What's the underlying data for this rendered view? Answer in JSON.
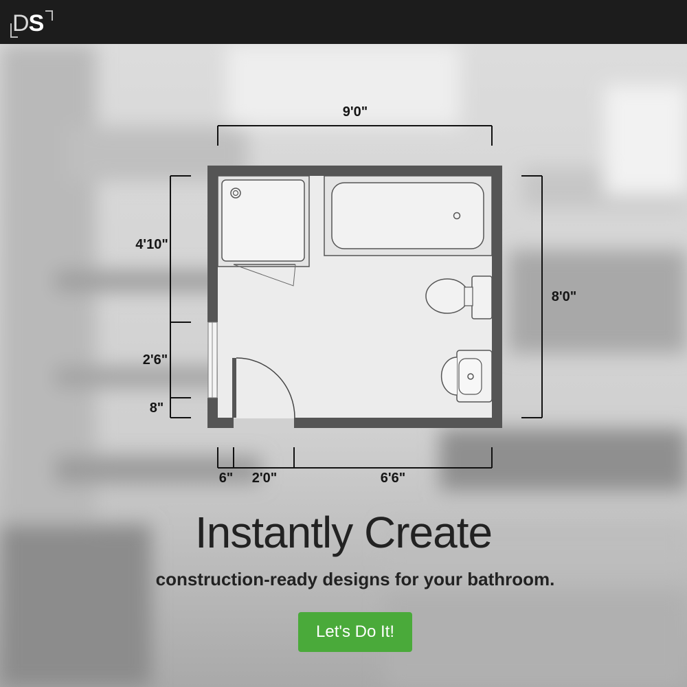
{
  "header": {
    "logo": {
      "text_d": "D",
      "text_s": "S"
    }
  },
  "floor_plan": {
    "dimensions": {
      "top_width": "9'0\"",
      "right_height": "8'0\"",
      "left_upper": "4'10\"",
      "left_middle": "2'6\"",
      "left_lower": "8\"",
      "bottom_left": "6\"",
      "bottom_door": "2'0\"",
      "bottom_right": "6'6\""
    }
  },
  "hero": {
    "headline": "Instantly Create",
    "subheadline": "construction-ready designs for your bathroom.",
    "cta_label": "Let's Do It!"
  },
  "colors": {
    "topbar": "#1c1c1c",
    "cta": "#4aaa3a",
    "wall": "#555555"
  }
}
